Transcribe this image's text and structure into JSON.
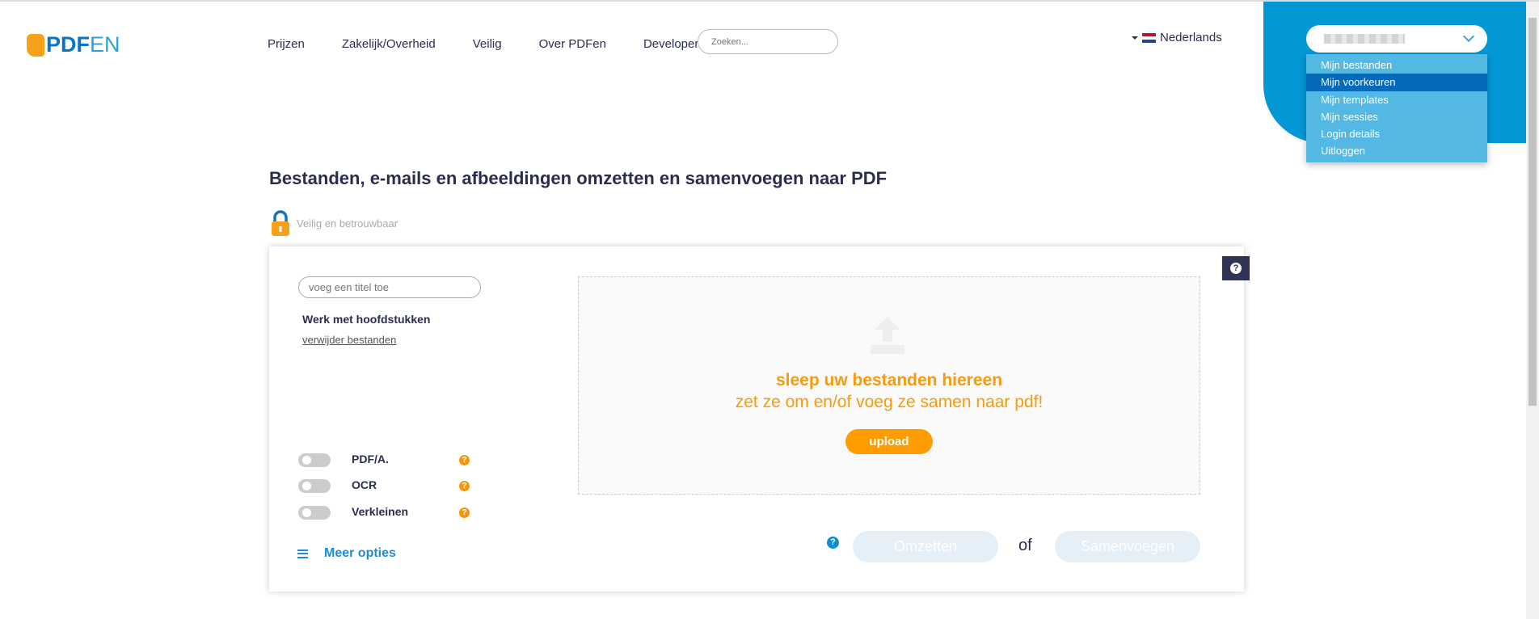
{
  "header": {
    "logo": "PDFEN",
    "logo_parts": [
      "PDF",
      "EN"
    ],
    "nav": [
      "Prijzen",
      "Zakelijk/Overheid",
      "Veilig",
      "Over PDFen",
      "Developers"
    ],
    "search_placeholder": "Zoeken...",
    "language": "Nederlands"
  },
  "user_menu": {
    "items": [
      "Mijn bestanden",
      "Mijn voorkeuren",
      "Mijn templates",
      "Mijn sessies",
      "Login details",
      "Uitloggen"
    ],
    "active": "Mijn voorkeuren"
  },
  "main": {
    "title": "Bestanden, e-mails en afbeeldingen omzetten en samenvoegen naar PDF",
    "secure": "Veilig en betrouwbaar",
    "title_input_placeholder": "voeg een titel toe",
    "chapters": "Werk met hoofdstukken",
    "remove_files": "verwijder bestanden",
    "drop_title": "sleep uw bestanden hiereen",
    "drop_subtitle": "zet ze om en/of voeg ze samen naar pdf!",
    "upload": "upload",
    "options": [
      {
        "label": "PDF/A.",
        "enabled": false
      },
      {
        "label": "OCR",
        "enabled": false
      },
      {
        "label": "Verkleinen",
        "enabled": false
      }
    ],
    "more_options": "Meer opties",
    "convert": "Omzetten",
    "or": "of",
    "merge": "Samenvoegen"
  },
  "colors": {
    "brand_blue": "#0398d5",
    "orange": "#fe9c00",
    "navy": "#2b2d4f"
  }
}
